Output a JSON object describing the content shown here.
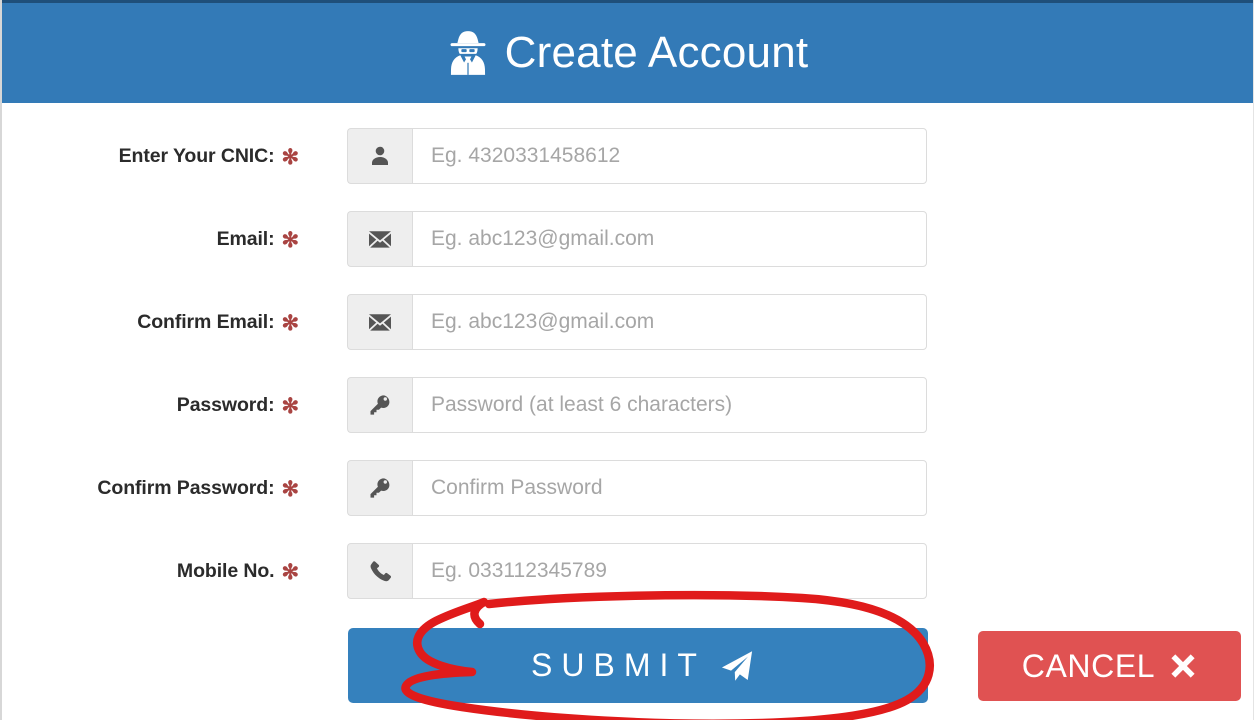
{
  "header": {
    "title": "Create Account",
    "icon": "user-secret-icon",
    "background_color": "#337ab7",
    "text_color": "#ffffff"
  },
  "form": {
    "required_marker": "✻",
    "required_marker_color": "#a94442",
    "fields": [
      {
        "label": "Enter Your CNIC:",
        "required": true,
        "icon": "user-icon",
        "name": "cnic",
        "placeholder": "Eg. 4320331458612",
        "value": ""
      },
      {
        "label": "Email:",
        "required": true,
        "icon": "envelope-icon",
        "name": "email",
        "placeholder": "Eg. abc123@gmail.com",
        "value": ""
      },
      {
        "label": "Confirm Email:",
        "required": true,
        "icon": "envelope-icon",
        "name": "confirm-email",
        "placeholder": "Eg. abc123@gmail.com",
        "value": ""
      },
      {
        "label": "Password:",
        "required": true,
        "icon": "key-icon",
        "name": "password",
        "placeholder": "Password (at least 6 characters)",
        "value": ""
      },
      {
        "label": "Confirm Password:",
        "required": true,
        "icon": "key-icon",
        "name": "confirm-password",
        "placeholder": "Confirm Password",
        "value": ""
      },
      {
        "label": "Mobile No.",
        "required": true,
        "icon": "phone-icon",
        "name": "mobile-no",
        "placeholder": "Eg. 033112345789",
        "value": ""
      }
    ]
  },
  "actions": {
    "submit": {
      "label": "SUBMIT",
      "icon": "paper-plane-icon",
      "color": "#3581bd"
    },
    "cancel": {
      "label": "CANCEL",
      "icon": "times-icon",
      "color": "#e05252"
    }
  },
  "annotation": {
    "type": "hand-drawn-ellipse",
    "target": "submit-button",
    "color": "#e01b1b"
  }
}
